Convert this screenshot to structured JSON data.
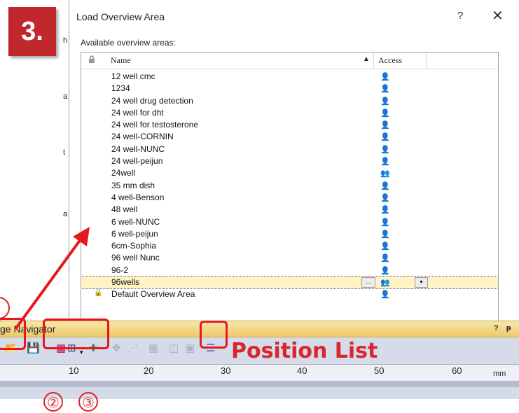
{
  "step_badge": "3.",
  "dialog": {
    "title": "Load Overview Area",
    "help_label": "?",
    "close_label": "✕",
    "available_label": "Available overview areas:",
    "columns": {
      "name": "Name",
      "access": "Access"
    },
    "items": [
      "12 well cmc",
      "1234",
      "24 well drug detection",
      "24 well for dht",
      "24 well for testosterone",
      "24 well-CORNIN",
      "24 well-NUNC",
      "24 well-peijun",
      "24well",
      "35 mm dish",
      "4 well-Benson",
      "48 well",
      "6 well-NUNC",
      "6 well-peijun",
      "6cm-Sophia",
      "96 well Nunc",
      "96-2",
      "96wells",
      "Default Overview Area"
    ],
    "selected_item": "96wells",
    "ellipsis_label": "..."
  },
  "panel": {
    "title": "ge Navigator",
    "pin_label": "? ᵽ",
    "callout": "Position List",
    "ruler": {
      "labels": [
        "10",
        "20",
        "30",
        "40",
        "50",
        "60"
      ],
      "unit": "mm"
    },
    "markers": [
      "②",
      "③"
    ]
  },
  "colors": {
    "annotation_red": "#e3191f",
    "panel_header": "#eec96a",
    "badge_bg": "#c0282d"
  }
}
